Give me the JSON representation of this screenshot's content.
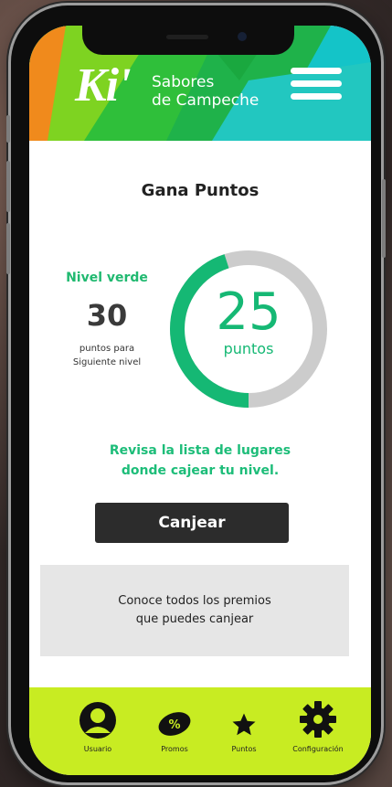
{
  "header": {
    "logo_main": "Ki'",
    "logo_line1": "Sabores",
    "logo_line2": "de Campeche",
    "menu_icon": "hamburger-menu-icon"
  },
  "main": {
    "title": "Gana Puntos",
    "level": {
      "name": "Nivel verde",
      "points_needed": "30",
      "description_line1": "puntos para",
      "description_line2": "Siguiente nivel"
    },
    "gauge": {
      "value": "25",
      "unit": "puntos",
      "fraction": 0.45,
      "colors": {
        "track": "#cccccc",
        "progress": "#15b874"
      }
    },
    "info_line1": "Revisa la lista de lugares",
    "info_line2": "donde cajear tu nivel.",
    "redeem_button": "Canjear",
    "premios_line1": "Conoce todos los premios",
    "premios_line2": "que puedes canjear"
  },
  "nav": {
    "items": [
      {
        "label": "Usuario",
        "icon": "user-icon"
      },
      {
        "label": "Promos",
        "icon": "percent-tag-icon"
      },
      {
        "label": "Puntos",
        "icon": "star-icon"
      },
      {
        "label": "Configuración",
        "icon": "gear-icon"
      }
    ],
    "background": "#c8ec22"
  },
  "colors": {
    "accent_green": "#15b874",
    "header_green": "#2fbf3a",
    "header_teal": "#14c4c8",
    "header_orange": "#f08a1c",
    "button_dark": "#2c2c2c"
  }
}
